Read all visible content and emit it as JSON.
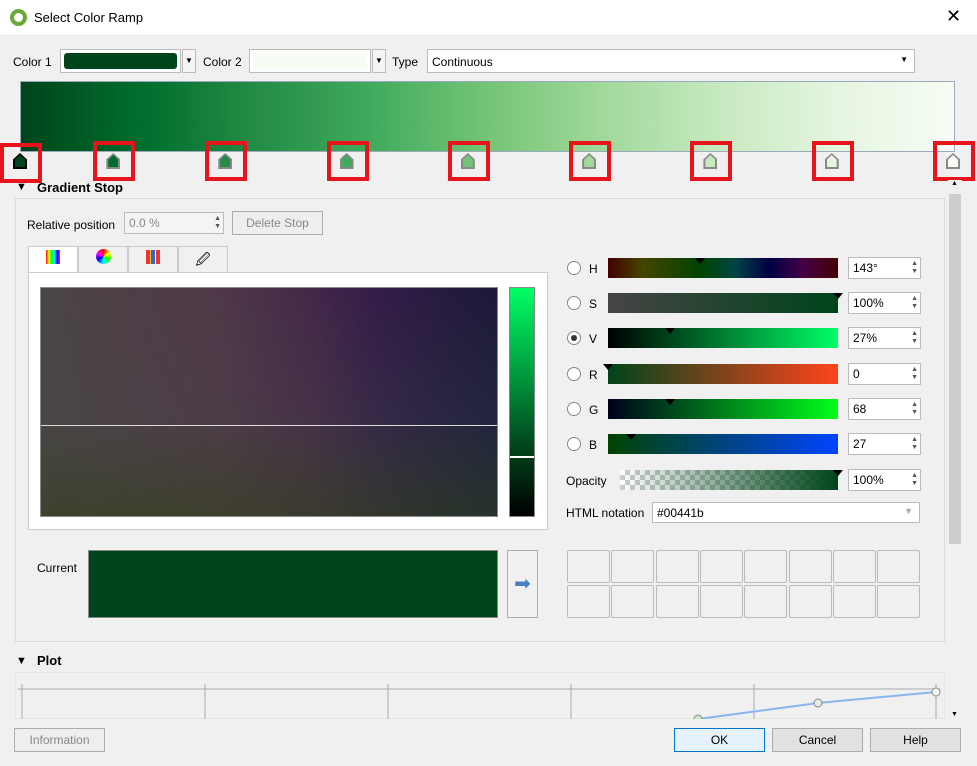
{
  "window": {
    "title": "Select Color Ramp",
    "close_icon": "close-icon"
  },
  "top": {
    "color1_label": "Color 1",
    "color1": "#00441b",
    "color2_label": "Color 2",
    "color2": "#f7fcf5",
    "type_label": "Type",
    "type_value": "Continuous"
  },
  "ramp": {
    "stops": [
      {
        "position": 0.0,
        "color": "#00441b"
      },
      {
        "position": 0.1,
        "color": "#006d2c"
      },
      {
        "position": 0.22,
        "color": "#238b45"
      },
      {
        "position": 0.35,
        "color": "#41ab5d"
      },
      {
        "position": 0.48,
        "color": "#74c476"
      },
      {
        "position": 0.61,
        "color": "#a1d99b"
      },
      {
        "position": 0.74,
        "color": "#c7e9c0"
      },
      {
        "position": 0.87,
        "color": "#e5f5e0"
      },
      {
        "position": 1.0,
        "color": "#f7fcf5"
      }
    ],
    "highlight_color": "#e8141c"
  },
  "gradient_stop": {
    "header": "Gradient Stop",
    "relative_position_label": "Relative position",
    "relative_position_value": "0.0 %",
    "delete_stop": "Delete Stop",
    "tabs": [
      "color-wheel-square",
      "color-wheel",
      "swatch-grid",
      "color-picker"
    ],
    "current_label": "Current",
    "current_color": "#00441b",
    "channels": [
      {
        "label": "H",
        "value": "143°",
        "fraction": 0.4,
        "selected": false
      },
      {
        "label": "S",
        "value": "100%",
        "fraction": 1.0,
        "selected": false
      },
      {
        "label": "V",
        "value": "27%",
        "fraction": 0.27,
        "selected": true
      },
      {
        "label": "R",
        "value": "0",
        "fraction": 0.0,
        "selected": false
      },
      {
        "label": "G",
        "value": "68",
        "fraction": 0.27,
        "selected": false
      },
      {
        "label": "B",
        "value": "27",
        "fraction": 0.1,
        "selected": false
      }
    ],
    "opacity_label": "Opacity",
    "opacity_value": "100%",
    "html_label": "HTML notation",
    "html_value": "#00441b"
  },
  "plot": {
    "header": "Plot"
  },
  "buttons": {
    "information": "Information",
    "ok": "OK",
    "cancel": "Cancel",
    "help": "Help"
  }
}
